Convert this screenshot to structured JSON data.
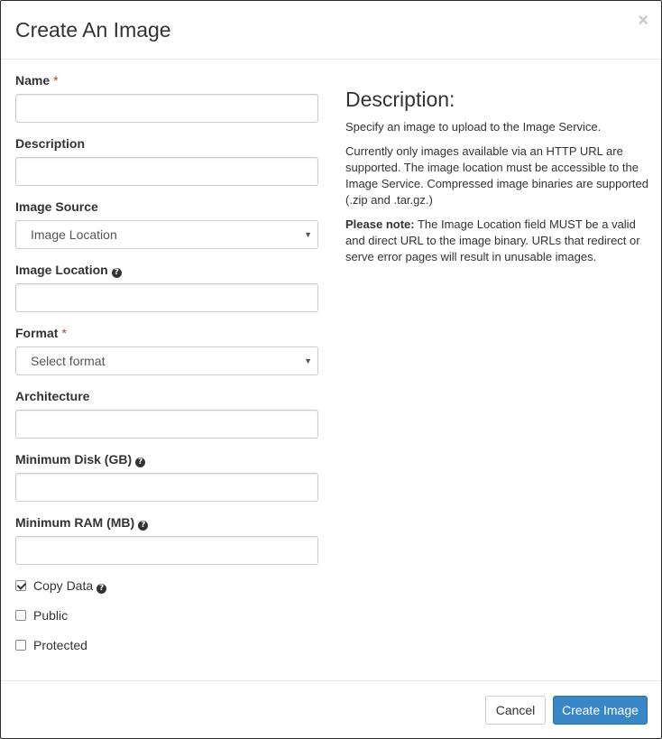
{
  "modal": {
    "title": "Create An Image",
    "close_symbol": "×"
  },
  "form": {
    "name": {
      "label": "Name",
      "required_mark": "*",
      "value": ""
    },
    "description": {
      "label": "Description",
      "value": ""
    },
    "image_source": {
      "label": "Image Source",
      "selected": "Image Location"
    },
    "image_location": {
      "label": "Image Location",
      "value": "",
      "help_icon": "question-circle-icon"
    },
    "format": {
      "label": "Format",
      "required_mark": "*",
      "selected": "Select format"
    },
    "architecture": {
      "label": "Architecture",
      "value": ""
    },
    "min_disk": {
      "label": "Minimum Disk (GB)",
      "value": "",
      "help_icon": "question-circle-icon"
    },
    "min_ram": {
      "label": "Minimum RAM (MB)",
      "value": "",
      "help_icon": "question-circle-icon"
    },
    "copy_data": {
      "label": "Copy Data",
      "checked": true,
      "help_icon": "question-circle-icon"
    },
    "public": {
      "label": "Public",
      "checked": false
    },
    "protected": {
      "label": "Protected",
      "checked": false
    }
  },
  "description_panel": {
    "heading": "Description:",
    "p1": "Specify an image to upload to the Image Service.",
    "p2": "Currently only images available via an HTTP URL are supported. The image location must be accessible to the Image Service. Compressed image binaries are supported (.zip and .tar.gz.)",
    "p3_bold": "Please note:",
    "p3_rest": " The Image Location field MUST be a valid and direct URL to the image binary. URLs that redirect or serve error pages will result in unusable images."
  },
  "footer": {
    "cancel_label": "Cancel",
    "create_label": "Create Image"
  },
  "colors": {
    "primary_button": "#3a87c8",
    "required_mark": "#c0392b",
    "border": "#cccccc"
  }
}
